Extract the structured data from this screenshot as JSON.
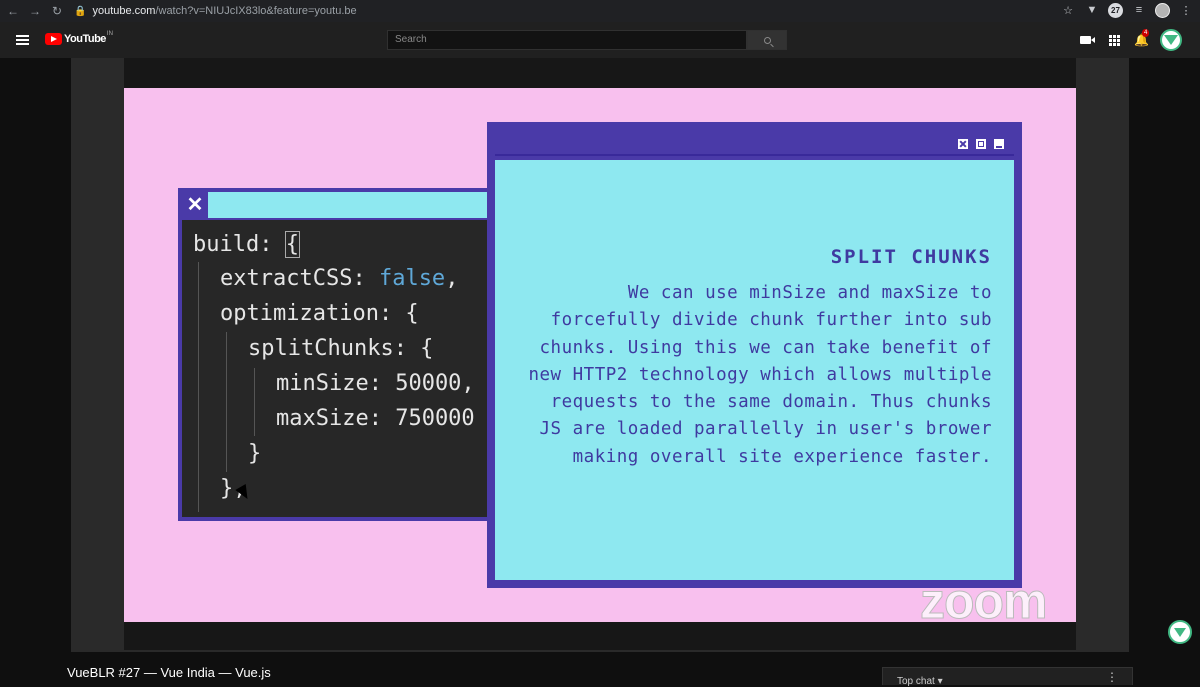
{
  "browser": {
    "url_domain": "youtube.com",
    "url_rest": "/watch?v=NIUJcIX83lo&feature=youtu.be",
    "ext_badge": "27"
  },
  "header": {
    "logo_text": "YouTube",
    "logo_region": "IN",
    "search_placeholder": "Search",
    "notification_count": "4"
  },
  "slide": {
    "code_lines": [
      {
        "indent": 0,
        "text": "build: ",
        "brace": "{"
      },
      {
        "indent": 1,
        "text": "extractCSS: ",
        "value": "false",
        "suffix": ","
      },
      {
        "indent": 1,
        "text": "optimization: {"
      },
      {
        "indent": 2,
        "text": "splitChunks: {"
      },
      {
        "indent": 3,
        "text": "minSize: 50000,"
      },
      {
        "indent": 3,
        "text": "maxSize: 750000"
      },
      {
        "indent": 2,
        "text": "}"
      },
      {
        "indent": 1,
        "text": "},"
      }
    ],
    "info_title": "SPLIT CHUNKS",
    "info_lines": [
      "We can use minSize and maxSize to",
      "forcefully divide chunk further into sub",
      "chunks. Using this we can take benefit of",
      "new HTTP2 technology which allows multiple",
      "requests to the same domain. Thus chunks",
      "JS are loaded parallelly in user's brower",
      "making overall site experience faster."
    ],
    "watermark": "zoom"
  },
  "video": {
    "title": "VueBLR #27 — Vue India — Vue.js"
  },
  "chat": {
    "label": "Top chat ▾",
    "more": "⋮"
  },
  "colors": {
    "slide_bg": "#f8c0ee",
    "window_purple": "#4a3aa8",
    "window_cyan": "#8ee8f0",
    "vue_green": "#41b883"
  }
}
